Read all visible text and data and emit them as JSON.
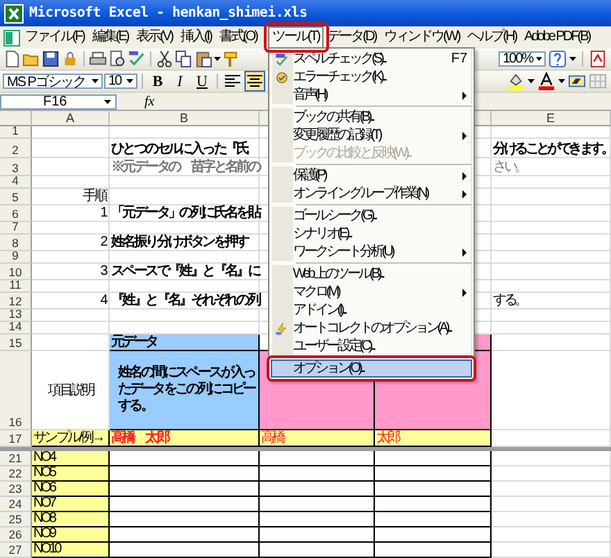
{
  "window": {
    "title": "Microsoft Excel - henkan_shimei.xls"
  },
  "menu_bar": [
    {
      "label": "ファイル(F)",
      "selected": false
    },
    {
      "label": "編集(E)",
      "selected": false
    },
    {
      "label": "表示(V)",
      "selected": false
    },
    {
      "label": "挿入(I)",
      "selected": false
    },
    {
      "label": "書式(O)",
      "selected": false
    },
    {
      "label": "ツール(T)",
      "selected": true
    },
    {
      "label": "データ(D)",
      "selected": false
    },
    {
      "label": "ウィンドウ(W)",
      "selected": false
    },
    {
      "label": "ヘルプ(H)",
      "selected": false
    },
    {
      "label": "Adobe PDF(B)",
      "selected": false
    }
  ],
  "standard_toolbar": {
    "zoom": "100%"
  },
  "formatting_toolbar": {
    "font": "MS Pゴシック",
    "size": "10",
    "bold": "B",
    "italic": "I",
    "underline": "U",
    "alignment": [
      {
        "kind": "left",
        "selected": false
      },
      {
        "kind": "center",
        "selected": true
      }
    ]
  },
  "formula_bar": {
    "name_box": "F16",
    "function_label": "fx"
  },
  "sheet": {
    "column_headers": [
      "A",
      "B",
      "E"
    ],
    "rows": [
      {
        "number": "1"
      },
      {
        "number": "2",
        "cells": {
          "b": {
            "text": "ひとつのセルに入った『氏",
            "kind": "title"
          },
          "e": {
            "text": "分けることができます。",
            "kind": "title"
          }
        }
      },
      {
        "number": "3",
        "cells": {
          "b": {
            "text": "※元データの　苗字と名前の",
            "kind": "note"
          },
          "e": {
            "text": "さい。",
            "kind": "note"
          }
        }
      },
      {
        "number": "4"
      },
      {
        "number": "5",
        "cells": {
          "a": {
            "text": "手順",
            "kind": "step"
          }
        }
      },
      {
        "number": "6",
        "cells": {
          "a": {
            "text": "1",
            "kind": "step"
          },
          "b": {
            "text": "「元データ」の列に氏名を貼",
            "kind": "text"
          }
        }
      },
      {
        "number": "7"
      },
      {
        "number": "8",
        "cells": {
          "a": {
            "text": "2",
            "kind": "step"
          },
          "b": {
            "text": "姓名振り分けボタンを押す",
            "kind": "text"
          }
        }
      },
      {
        "number": "9"
      },
      {
        "number": "10",
        "cells": {
          "a": {
            "text": "3",
            "kind": "step"
          },
          "b": {
            "text": "スペースで『姓』と『名』に",
            "kind": "text"
          }
        }
      },
      {
        "number": "11"
      },
      {
        "number": "12",
        "cells": {
          "a": {
            "text": "4",
            "kind": "step"
          },
          "b": {
            "text": "『姓』と『名』それぞれの列",
            "kind": "text"
          },
          "e": {
            "text": "する。",
            "kind": "text"
          }
        }
      },
      {
        "number": "13"
      },
      {
        "number": "14"
      },
      {
        "number": "15",
        "cells": {
          "b": {
            "text": "元データ",
            "kind": "text",
            "color": "#99ccff"
          },
          "d": {
            "color": "#ff99cc"
          }
        }
      },
      {
        "number": "16",
        "cells": {
          "a": {
            "text": "項目説明",
            "kind": "label"
          },
          "b": {
            "text": "姓名の間にスペースが入ったデータをこの列にコピーする。",
            "kind": "wrap",
            "color": "#99ccff"
          },
          "c": {
            "color": "#ff99cc"
          },
          "d": {
            "color": "#ff99cc"
          }
        }
      },
      {
        "number": "17",
        "cells": {
          "a": {
            "text": "サンプル/例→",
            "kind": "text",
            "color": "#ffff99"
          },
          "b": {
            "text": "高橋　太郎",
            "kind": "sample",
            "color": "#ffff99"
          },
          "c": {
            "text": "高橋",
            "kind": "sample",
            "color": "#ffff99"
          },
          "d": {
            "text": "太郎",
            "kind": "sample",
            "color": "#ffff99"
          }
        }
      },
      {
        "number": "21",
        "cells": {
          "a": {
            "text": "NO4",
            "kind": "text",
            "color": "#ffff99"
          }
        }
      },
      {
        "number": "22",
        "cells": {
          "a": {
            "text": "NO5",
            "kind": "text",
            "color": "#ffff99"
          }
        }
      },
      {
        "number": "23",
        "cells": {
          "a": {
            "text": "NO6",
            "kind": "text",
            "color": "#ffff99"
          }
        }
      },
      {
        "number": "24",
        "cells": {
          "a": {
            "text": "NO7",
            "kind": "text",
            "color": "#ffff99"
          }
        }
      },
      {
        "number": "25",
        "cells": {
          "a": {
            "text": "NO8",
            "kind": "text",
            "color": "#ffff99"
          }
        }
      },
      {
        "number": "26",
        "cells": {
          "a": {
            "text": "NO9",
            "kind": "text",
            "color": "#ffff99"
          }
        }
      },
      {
        "number": "27",
        "cells": {
          "a": {
            "text": "NO10",
            "kind": "text",
            "color": "#ffff99"
          }
        }
      }
    ]
  },
  "tools_menu": {
    "items": [
      {
        "kind": "item",
        "label": "スペル チェック(S)...",
        "shortcut": "F7",
        "selected": false,
        "disabled": false
      },
      {
        "kind": "item",
        "label": "エラー チェック(K)...",
        "selected": false,
        "disabled": false
      },
      {
        "kind": "submenu",
        "label": "音声(H)",
        "selected": false,
        "disabled": false
      },
      {
        "kind": "separator"
      },
      {
        "kind": "item",
        "label": "ブックの共有(B)...",
        "selected": false,
        "disabled": false
      },
      {
        "kind": "submenu",
        "label": "変更履歴の記録(T)",
        "selected": false,
        "disabled": false
      },
      {
        "kind": "item",
        "label": "ブックの比較と反映(W)...",
        "selected": false,
        "disabled": true
      },
      {
        "kind": "separator"
      },
      {
        "kind": "submenu",
        "label": "保護(P)",
        "selected": false,
        "disabled": false
      },
      {
        "kind": "submenu",
        "label": "オンライン グループ作業(N)",
        "selected": false,
        "disabled": false
      },
      {
        "kind": "separator"
      },
      {
        "kind": "item",
        "label": "ゴール シーク(G)...",
        "selected": false,
        "disabled": false
      },
      {
        "kind": "item",
        "label": "シナリオ(E)...",
        "selected": false,
        "disabled": false
      },
      {
        "kind": "submenu",
        "label": "ワークシート分析(U)",
        "selected": false,
        "disabled": false
      },
      {
        "kind": "separator"
      },
      {
        "kind": "item",
        "label": "Web 上のツール(B)...",
        "selected": false,
        "disabled": false
      },
      {
        "kind": "submenu",
        "label": "マクロ(M)",
        "selected": false,
        "disabled": false
      },
      {
        "kind": "item",
        "label": "アドイン(I)...",
        "selected": false,
        "disabled": false
      },
      {
        "kind": "item",
        "label": "オートコレクトのオプション(A)...",
        "selected": false,
        "disabled": false
      },
      {
        "kind": "item",
        "label": "ユーザー設定(C)...",
        "selected": false,
        "disabled": false
      },
      {
        "kind": "item",
        "label": "オプション(O)...",
        "selected": true,
        "disabled": false
      }
    ]
  }
}
